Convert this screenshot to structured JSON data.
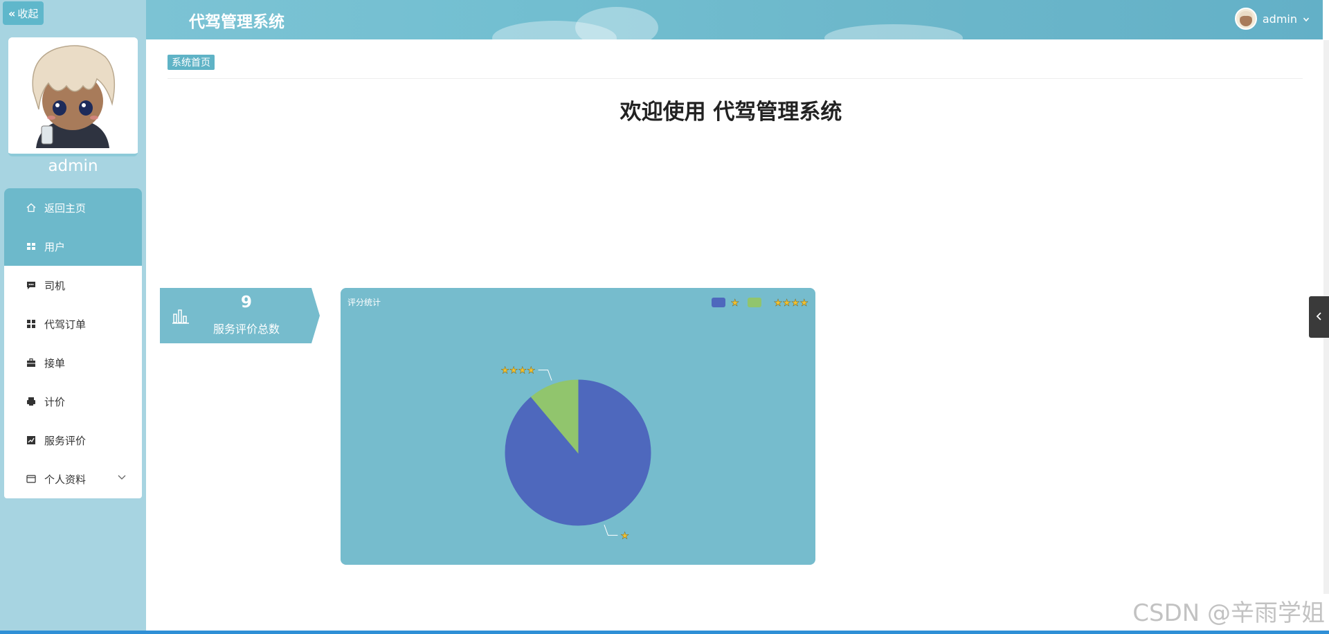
{
  "sidebar": {
    "collapse_label": "收起",
    "username": "admin",
    "items": [
      {
        "label": "返回主页",
        "icon": "home-icon"
      },
      {
        "label": "用户",
        "icon": "grid-icon"
      },
      {
        "label": "司机",
        "icon": "chat-icon"
      },
      {
        "label": "代驾订单",
        "icon": "grid-icon"
      },
      {
        "label": "接单",
        "icon": "briefcase-icon"
      },
      {
        "label": "计价",
        "icon": "printer-icon"
      },
      {
        "label": "服务评价",
        "icon": "chart-icon"
      },
      {
        "label": "个人资料",
        "icon": "card-icon"
      }
    ]
  },
  "header": {
    "title": "代驾管理系统",
    "user": "admin"
  },
  "breadcrumb": "系统首页",
  "welcome": "欢迎使用 代驾管理系统",
  "stat": {
    "value": "9",
    "label": "服务评价总数"
  },
  "chart_data": {
    "type": "pie",
    "title": "评分统计",
    "slices": [
      {
        "name": "★",
        "value": 8,
        "color": "#4e68bd"
      },
      {
        "name": "★★★★",
        "value": 1,
        "color": "#91c56d"
      }
    ],
    "legend_position": "top-right"
  },
  "watermark": "CSDN @辛雨学姐",
  "colors": {
    "accent": "#6db9cb",
    "sidebar_bg": "#a7d4e1",
    "panel": "#76bccd"
  }
}
